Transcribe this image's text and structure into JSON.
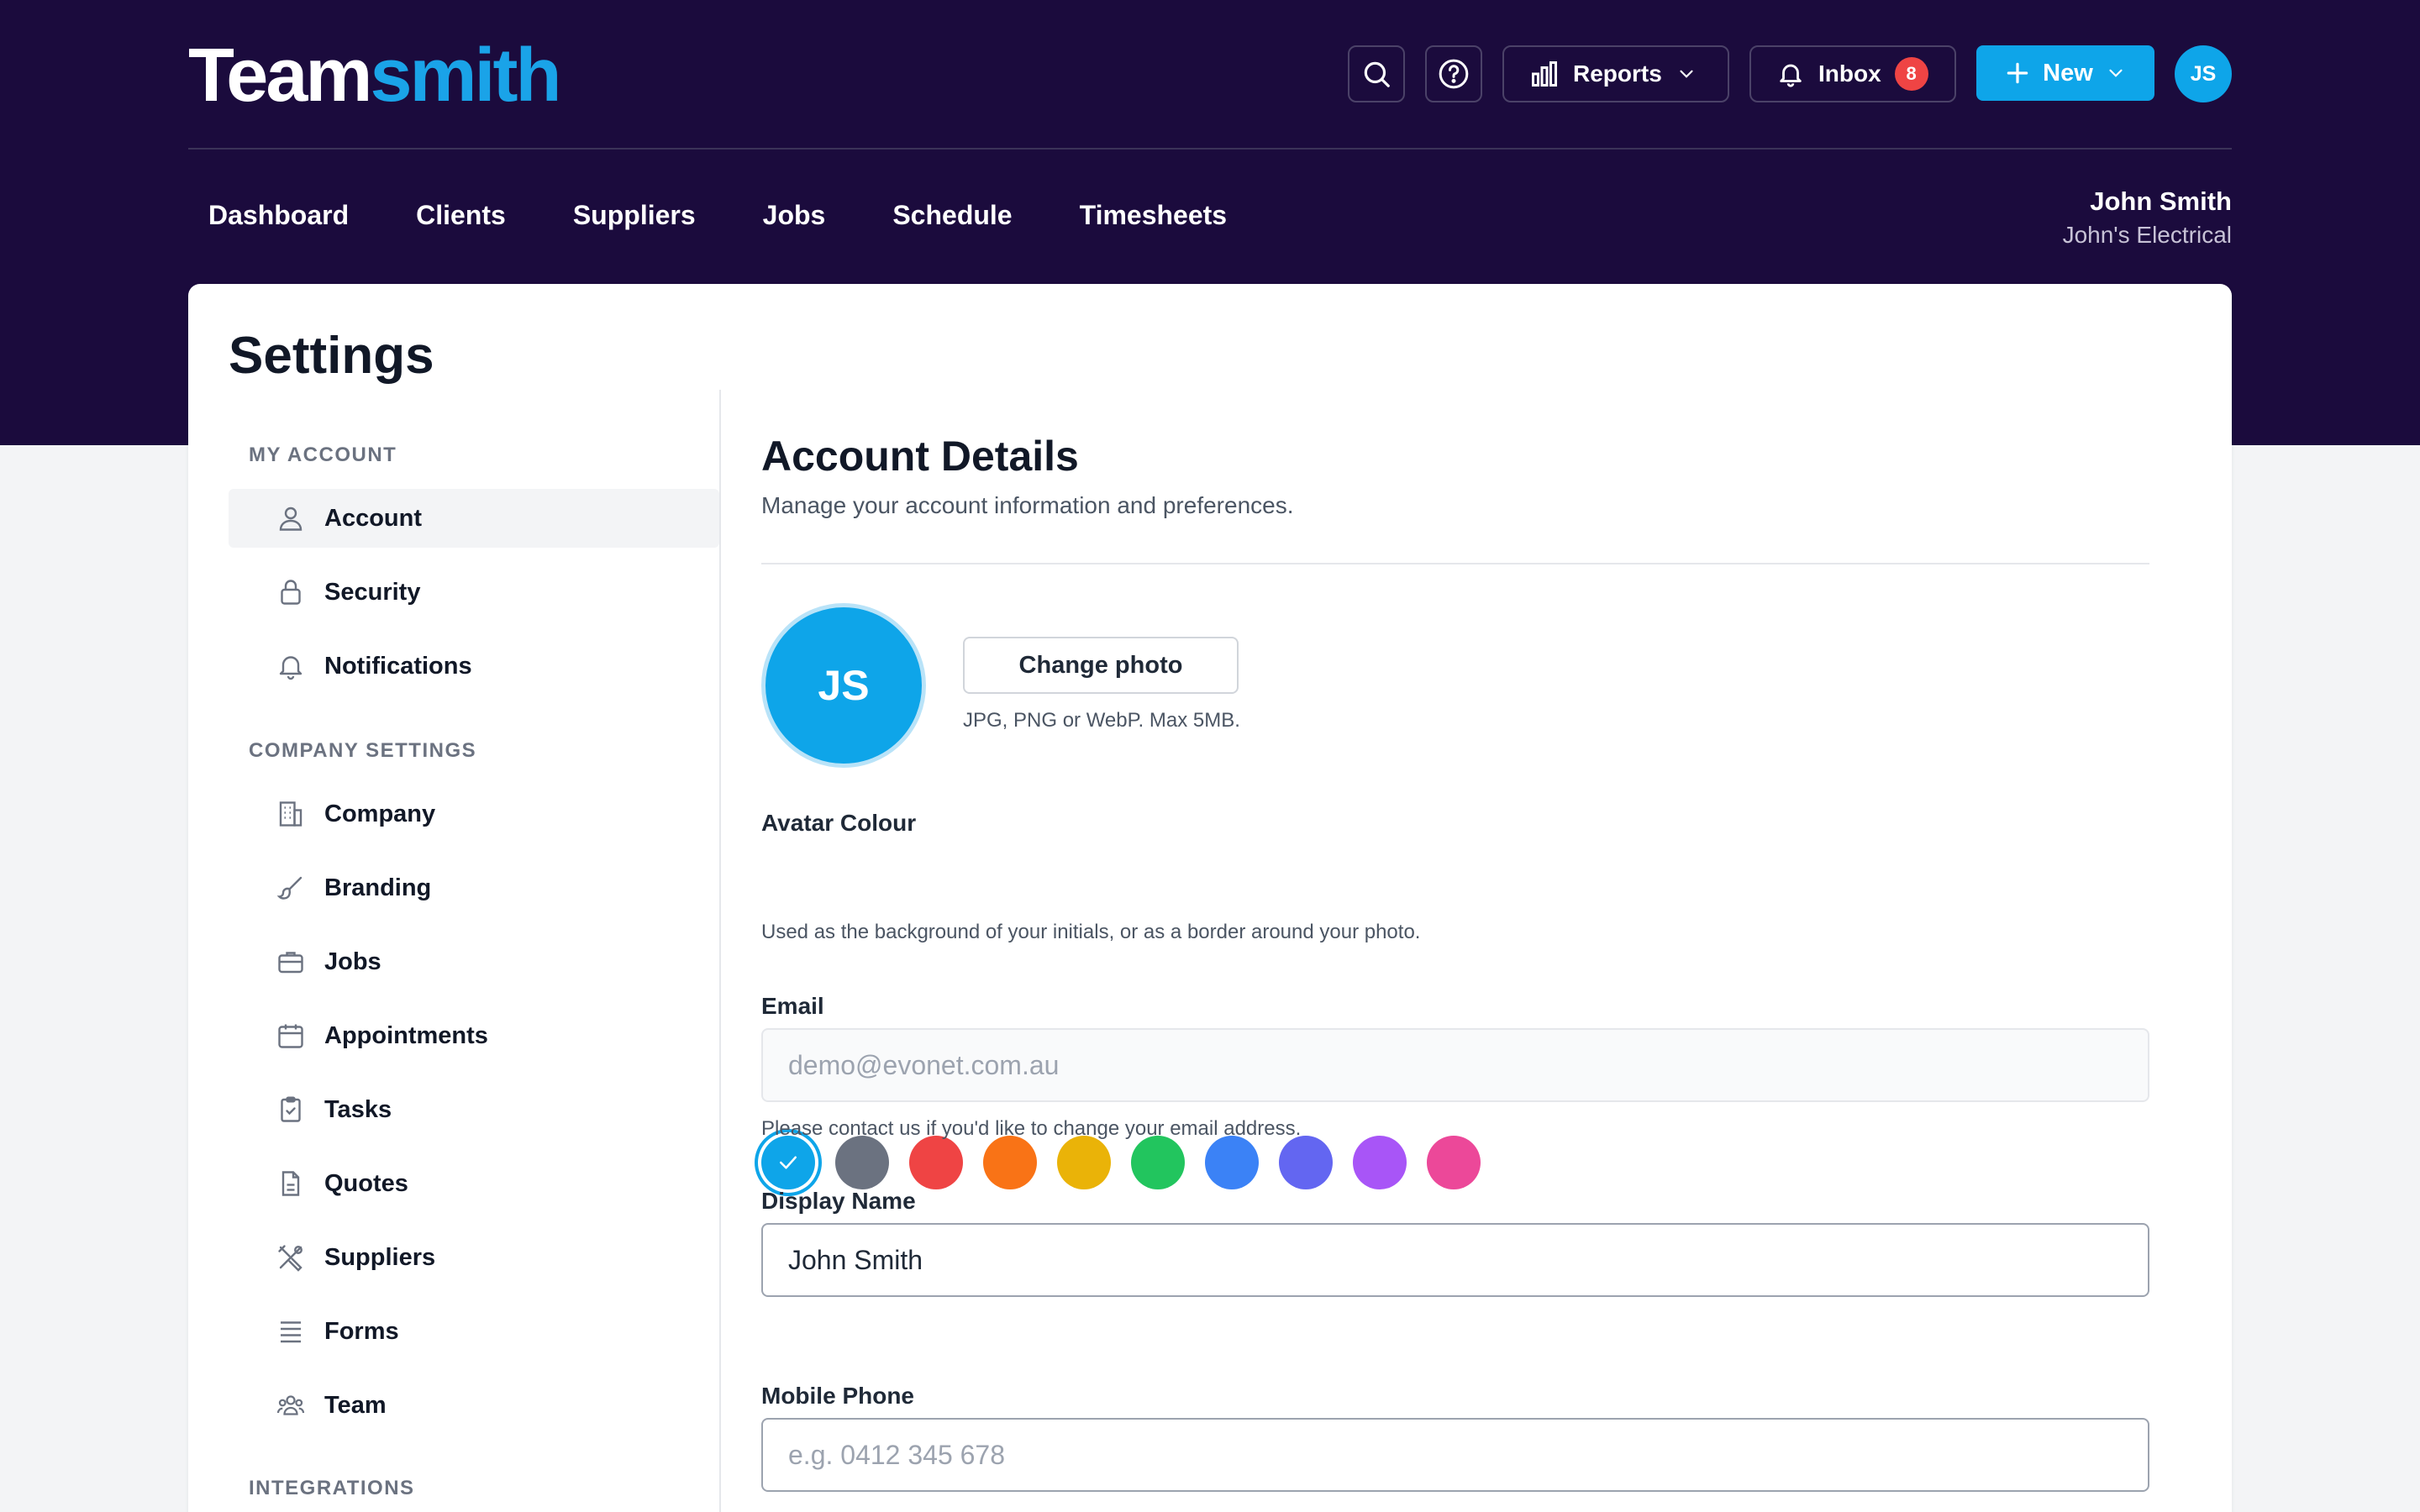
{
  "app": {
    "logo_part1": "Team",
    "logo_part2": "smith"
  },
  "topbar": {
    "reports_label": "Reports",
    "inbox_label": "Inbox",
    "inbox_count": "8",
    "new_label": "New",
    "avatar_initials": "JS"
  },
  "nav": {
    "items": [
      "Dashboard",
      "Clients",
      "Suppliers",
      "Jobs",
      "Schedule",
      "Timesheets"
    ]
  },
  "user": {
    "name": "John Smith",
    "company": "John's Electrical"
  },
  "page": {
    "title": "Settings"
  },
  "sidebar": {
    "sections": [
      {
        "label": "MY ACCOUNT",
        "items": [
          {
            "label": "Account",
            "icon": "user-icon",
            "active": true
          },
          {
            "label": "Security",
            "icon": "lock-icon"
          },
          {
            "label": "Notifications",
            "icon": "bell-icon"
          }
        ]
      },
      {
        "label": "COMPANY SETTINGS",
        "items": [
          {
            "label": "Company",
            "icon": "building-icon"
          },
          {
            "label": "Branding",
            "icon": "brush-icon"
          },
          {
            "label": "Jobs",
            "icon": "briefcase-icon"
          },
          {
            "label": "Appointments",
            "icon": "calendar-icon"
          },
          {
            "label": "Tasks",
            "icon": "clipboard-check-icon"
          },
          {
            "label": "Quotes",
            "icon": "document-icon"
          },
          {
            "label": "Suppliers",
            "icon": "tools-icon"
          },
          {
            "label": "Forms",
            "icon": "list-icon"
          },
          {
            "label": "Team",
            "icon": "team-icon"
          }
        ]
      },
      {
        "label": "INTEGRATIONS",
        "items": []
      }
    ]
  },
  "account": {
    "title": "Account Details",
    "subtitle": "Manage your account information and preferences.",
    "avatar_initials": "JS",
    "change_photo_label": "Change photo",
    "photo_hint": "JPG, PNG or WebP. Max 5MB.",
    "avatar_colour_label": "Avatar Colour",
    "avatar_colours": [
      "#0ea5e9",
      "#6b7280",
      "#ef4444",
      "#f97316",
      "#eab308",
      "#22c55e",
      "#3b82f6",
      "#6366f1",
      "#a855f7",
      "#ec4899"
    ],
    "selected_colour_index": 0,
    "avatar_colour_help": "Used as the background of your initials, or as a border around your photo.",
    "email_label": "Email",
    "email_value": "demo@evonet.com.au",
    "email_help": "Please contact us if you'd like to change your email address.",
    "display_name_label": "Display Name",
    "display_name_value": "John Smith",
    "mobile_label": "Mobile Phone",
    "mobile_placeholder": "e.g. 0412 345 678"
  }
}
